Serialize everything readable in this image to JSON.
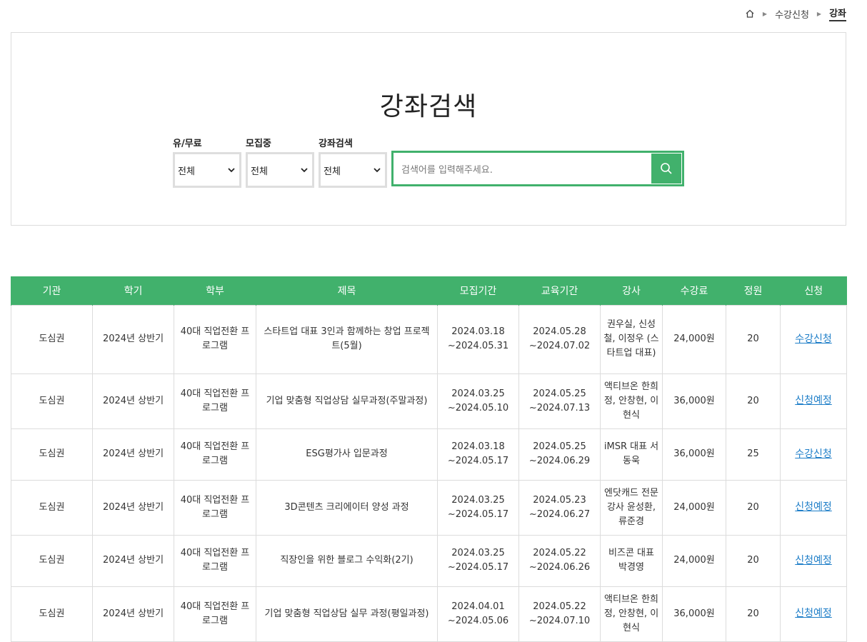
{
  "breadcrumb": {
    "items": [
      "수강신청",
      "강좌"
    ]
  },
  "search": {
    "title": "강좌검색",
    "filters": [
      {
        "label": "유/무료",
        "value": "전체"
      },
      {
        "label": "모집중",
        "value": "전체"
      },
      {
        "label": "강좌검색",
        "value": "전체"
      }
    ],
    "placeholder": "검색어를 입력해주세요."
  },
  "colors": {
    "accent": "#41b16c",
    "link": "#1e7ec8"
  },
  "table": {
    "headers": [
      "기관",
      "학기",
      "학부",
      "제목",
      "모집기간",
      "교육기간",
      "강사",
      "수강료",
      "정원",
      "신청"
    ],
    "rows": [
      {
        "org": "도심권",
        "term": "2024년 상반기",
        "dept": "40대 직업전환 프로그램",
        "title": "스타트업 대표 3인과 함께하는 창업 프로젝트(5월)",
        "recruit": "2024.03.18 ~2024.05.31",
        "edu": "2024.05.28 ~2024.07.02",
        "lecturer": "권우실, 신성철, 이정우 (스타트업 대표)",
        "fee": "24,000원",
        "cap": "20",
        "apply": "수강신청"
      },
      {
        "org": "도심권",
        "term": "2024년 상반기",
        "dept": "40대 직업전환 프로그램",
        "title": "기업 맞춤형 직업상담 실무과정(주말과정)",
        "recruit": "2024.03.25 ~2024.05.10",
        "edu": "2024.05.25 ~2024.07.13",
        "lecturer": "액티브온 한희정, 안창현, 이현식",
        "fee": "36,000원",
        "cap": "20",
        "apply": "신청예정"
      },
      {
        "org": "도심권",
        "term": "2024년 상반기",
        "dept": "40대 직업전환 프로그램",
        "title": "ESG평가사 입문과정",
        "recruit": "2024.03.18 ~2024.05.17",
        "edu": "2024.05.25 ~2024.06.29",
        "lecturer": "iMSR 대표 서동욱",
        "fee": "36,000원",
        "cap": "25",
        "apply": "수강신청"
      },
      {
        "org": "도심권",
        "term": "2024년 상반기",
        "dept": "40대 직업전환 프로그램",
        "title": "3D콘텐츠 크리에이터 양성 과정",
        "recruit": "2024.03.25 ~2024.05.17",
        "edu": "2024.05.23 ~2024.06.27",
        "lecturer": "엔닷캐드 전문강사 윤성환, 류준경",
        "fee": "24,000원",
        "cap": "20",
        "apply": "신청예정"
      },
      {
        "org": "도심권",
        "term": "2024년 상반기",
        "dept": "40대 직업전환 프로그램",
        "title": "직장인을 위한 블로그 수익화(2기)",
        "recruit": "2024.03.25 ~2024.05.17",
        "edu": "2024.05.22 ~2024.06.26",
        "lecturer": "비즈콘 대표 박경영",
        "fee": "24,000원",
        "cap": "20",
        "apply": "신청예정"
      },
      {
        "org": "도심권",
        "term": "2024년 상반기",
        "dept": "40대 직업전환 프로그램",
        "title": "기업 맞춤형 직업상담 실무 과정(평일과정)",
        "recruit": "2024.04.01 ~2024.05.06",
        "edu": "2024.05.22 ~2024.07.10",
        "lecturer": "액티브온 한희정, 안창현, 이현식",
        "fee": "36,000원",
        "cap": "20",
        "apply": "신청예정"
      }
    ]
  }
}
